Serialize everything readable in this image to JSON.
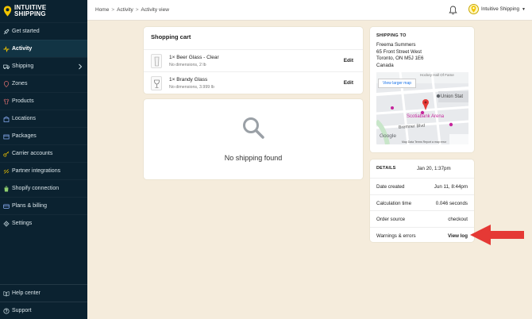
{
  "brand": {
    "line1": "INTUITIVE",
    "line2": "SHIPPING"
  },
  "sidebar": {
    "items": [
      {
        "label": "Get started",
        "icon": "rocket-icon"
      },
      {
        "label": "Activity",
        "icon": "activity-icon",
        "active": true
      },
      {
        "label": "Shipping",
        "icon": "truck-icon",
        "has_children": true
      },
      {
        "label": "Zones",
        "icon": "location-pin-icon"
      },
      {
        "label": "Products",
        "icon": "shirt-icon"
      },
      {
        "label": "Locations",
        "icon": "building-icon"
      },
      {
        "label": "Packages",
        "icon": "package-icon"
      },
      {
        "label": "Carrier accounts",
        "icon": "key-icon"
      },
      {
        "label": "Partner integrations",
        "icon": "link-icon"
      },
      {
        "label": "Shopify connection",
        "icon": "shopify-icon"
      },
      {
        "label": "Plans & billing",
        "icon": "card-icon"
      },
      {
        "label": "Settings",
        "icon": "gear-icon"
      }
    ],
    "bottom": [
      {
        "label": "Help center",
        "icon": "book-icon"
      },
      {
        "label": "Support",
        "icon": "help-circle-icon"
      }
    ]
  },
  "breadcrumb": {
    "home": "Home",
    "activity": "Activity",
    "current": "Activity view",
    "sep": ">"
  },
  "account": {
    "name": "Intuitive Shipping"
  },
  "cart": {
    "title": "Shopping cart",
    "items": [
      {
        "name": "1× Beer Glass - Clear",
        "dims": "No dimensions, 2 lb",
        "edit": "Edit"
      },
      {
        "name": "1× Brandy Glass",
        "dims": "No dimensions, 3.999 lb",
        "edit": "Edit"
      }
    ]
  },
  "no_shipping": {
    "message": "No shipping found"
  },
  "ship_to": {
    "label": "SHIPPING TO",
    "name": "Freema Summers",
    "street": "65 Front Street West",
    "city": "Toronto, ON M5J 1E6",
    "country": "Canada",
    "map_button": "View larger map",
    "map_labels": {
      "union": "Union Stat",
      "arena": "Scotiabank Arena",
      "bremner": "Bremner Blvd",
      "hockey": "Hockey Hall Of Fame",
      "google": "Google",
      "footer": "Map Data   Terms   Report a map error"
    }
  },
  "details": {
    "label": "DETAILS",
    "date": "Jan 20, 1:37pm",
    "rows": [
      {
        "key": "Date created",
        "value": "Jun 11, 8:44pm"
      },
      {
        "key": "Calculation time",
        "value": "0.046 seconds"
      },
      {
        "key": "Order source",
        "value": "checkout"
      },
      {
        "key": "Warnings & errors",
        "value": "View log"
      }
    ]
  },
  "colors": {
    "sidebar_bg": "#0b2230",
    "page_bg": "#f5ecdc",
    "accent_yellow": "#f2c500",
    "arrow_red": "#e53935"
  }
}
